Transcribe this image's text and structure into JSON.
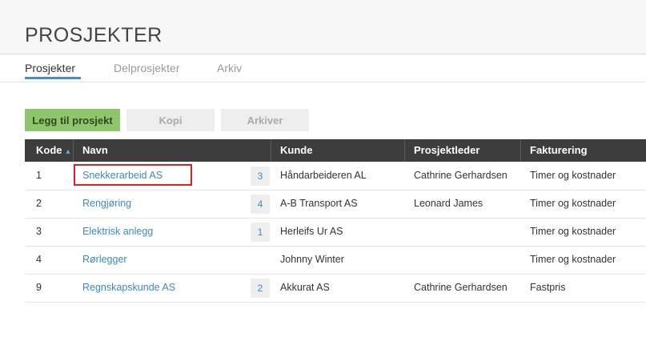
{
  "page": {
    "title": "PROSJEKTER"
  },
  "tabs": [
    {
      "label": "Prosjekter",
      "active": true
    },
    {
      "label": "Delprosjekter",
      "active": false
    },
    {
      "label": "Arkiv",
      "active": false
    }
  ],
  "toolbar": {
    "add_label": "Legg til prosjekt",
    "copy_label": "Kopi",
    "archive_label": "Arkiver"
  },
  "table": {
    "columns": [
      "Kode",
      "Navn",
      "Kunde",
      "Prosjektleder",
      "Fakturering"
    ],
    "sort_indicator": "▲",
    "rows": [
      {
        "kode": "1",
        "navn": "Snekkerarbeid AS",
        "count": "3",
        "kunde": "Håndarbeideren AL",
        "leder": "Cathrine Gerhardsen",
        "fakturering": "Timer og kostnader"
      },
      {
        "kode": "2",
        "navn": "Rengjøring",
        "count": "4",
        "kunde": "A-B Transport AS",
        "leder": "Leonard James",
        "fakturering": "Timer og kostnader"
      },
      {
        "kode": "3",
        "navn": "Elektrisk anlegg",
        "count": "1",
        "kunde": "Herleifs Ur AS",
        "leder": "",
        "fakturering": "Timer og kostnader"
      },
      {
        "kode": "4",
        "navn": "Rørlegger",
        "count": "",
        "kunde": "Johnny Winter",
        "leder": "",
        "fakturering": "Timer og kostnader"
      },
      {
        "kode": "9",
        "navn": "Regnskapskunde AS",
        "count": "2",
        "kunde": "Akkurat AS",
        "leder": "Cathrine Gerhardsen",
        "fakturering": "Fastpris"
      }
    ]
  },
  "colors": {
    "accent": "#3b8bc2",
    "primary_button": "#8fc66b",
    "header_bg": "#3d3d3d",
    "highlight": "#e02020"
  }
}
